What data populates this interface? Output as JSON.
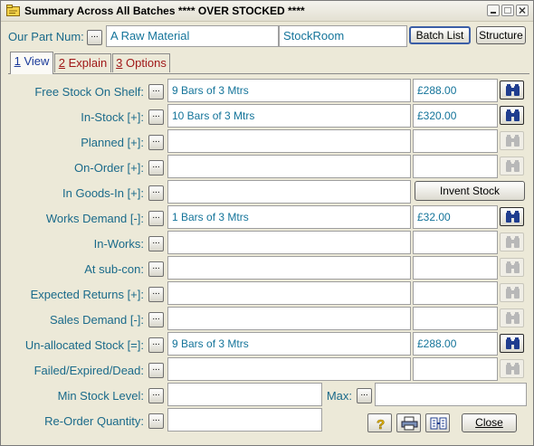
{
  "window": {
    "title": "Summary Across All Batches **** OVER STOCKED ****"
  },
  "header": {
    "part_label": "Our Part Num:",
    "part_value": "A Raw Material",
    "location_value": "StockRoom",
    "batch_list_label": "Batch List",
    "structure_label": "Structure"
  },
  "tabs": [
    {
      "num": "1",
      "label": " View"
    },
    {
      "num": "2",
      "label": " Explain"
    },
    {
      "num": "3",
      "label": " Options"
    }
  ],
  "rows": [
    {
      "label": "Free Stock On Shelf:",
      "desc": "9 Bars of 3 Mtrs",
      "value": "£288.00",
      "icon_state": "active"
    },
    {
      "label": "In-Stock [+]:",
      "desc": "10 Bars of 3 Mtrs",
      "value": "£320.00",
      "icon_state": "active"
    },
    {
      "label": "Planned [+]:",
      "desc": "",
      "value": "",
      "icon_state": "disabled"
    },
    {
      "label": "On-Order [+]:",
      "desc": "",
      "value": "",
      "icon_state": "disabled"
    },
    {
      "label": "In Goods-In [+]:",
      "desc": "",
      "value": "",
      "icon_state": "none"
    },
    {
      "label": "Works Demand [-]:",
      "desc": "1 Bars of 3 Mtrs",
      "value": "£32.00",
      "icon_state": "active"
    },
    {
      "label": "In-Works:",
      "desc": "",
      "value": "",
      "icon_state": "disabled"
    },
    {
      "label": "At sub-con:",
      "desc": "",
      "value": "",
      "icon_state": "disabled"
    },
    {
      "label": "Expected Returns [+]:",
      "desc": "",
      "value": "",
      "icon_state": "disabled"
    },
    {
      "label": "Sales Demand [-]:",
      "desc": "",
      "value": "",
      "icon_state": "disabled"
    },
    {
      "label": "Un-allocated Stock [=]:",
      "desc": "9 Bars of 3 Mtrs",
      "value": "£288.00",
      "icon_state": "active"
    },
    {
      "label": "Failed/Expired/Dead:",
      "desc": "",
      "value": "",
      "icon_state": "disabled"
    }
  ],
  "invent_stock_label": "Invent Stock",
  "min_stock": {
    "label": "Min Stock Level:",
    "value": ""
  },
  "max": {
    "label": "Max:",
    "value": ""
  },
  "reorder": {
    "label": "Re-Order Quantity:",
    "value": ""
  },
  "footer": {
    "close_label": "Close"
  },
  "colors": {
    "label_text": "#1a6a8a",
    "field_text": "#14749a",
    "icon_blue": "#1f3d8f",
    "tab_inactive": "#a01818"
  }
}
